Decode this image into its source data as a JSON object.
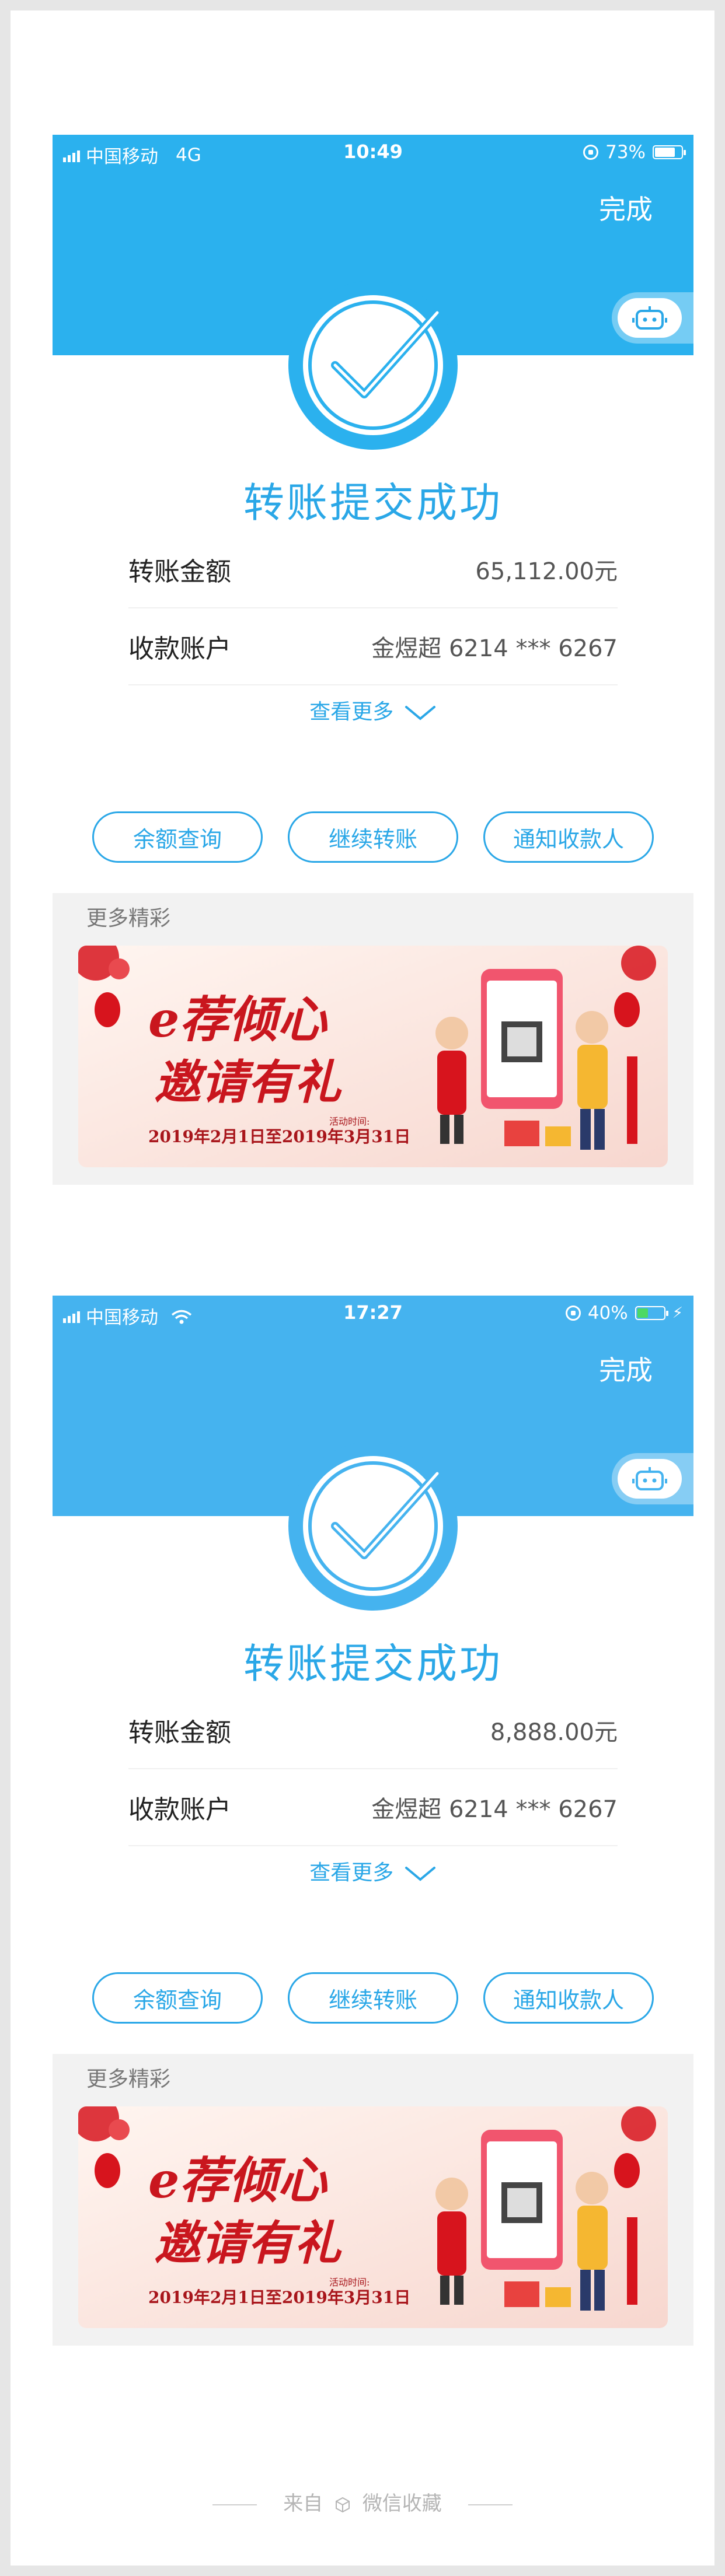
{
  "screens": [
    {
      "status": {
        "carrier": "中国移动",
        "network": "4G",
        "time": "10:49",
        "battery": "73%",
        "battery_level": 0.73
      },
      "header": {
        "done_label": "完成"
      },
      "title": "转账提交成功",
      "rows": [
        {
          "label": "转账金额",
          "value": "65,112.00元"
        },
        {
          "label": "收款账户",
          "value": "金煜超 6214 *** 6267"
        }
      ],
      "more_link": "查看更多",
      "buttons": [
        "余额查询",
        "继续转账",
        "通知收款人"
      ],
      "more_section": {
        "heading": "更多精彩",
        "banner": {
          "slogan1": "e荐倾心",
          "slogan2": "邀请有礼",
          "hint": "活动时间:",
          "dates": "2019年2月1日至2019年3月31日"
        }
      }
    },
    {
      "status": {
        "carrier": "中国移动",
        "network": "wifi",
        "time": "17:27",
        "battery": "40%",
        "battery_level": 0.4
      },
      "header": {
        "done_label": "完成"
      },
      "title": "转账提交成功",
      "rows": [
        {
          "label": "转账金额",
          "value": "8,888.00元"
        },
        {
          "label": "收款账户",
          "value": "金煜超 6214 *** 6267"
        }
      ],
      "more_link": "查看更多",
      "buttons": [
        "余额查询",
        "继续转账",
        "通知收款人"
      ],
      "more_section": {
        "heading": "更多精彩",
        "banner": {
          "slogan1": "e荐倾心",
          "slogan2": "邀请有礼",
          "hint": "活动时间:",
          "dates": "2019年2月1日至2019年3月31日"
        }
      }
    }
  ],
  "footer": {
    "from": "来自",
    "source": "微信收藏"
  },
  "colors": {
    "header": "#2bb1ee",
    "accent": "#2aa7e7"
  }
}
